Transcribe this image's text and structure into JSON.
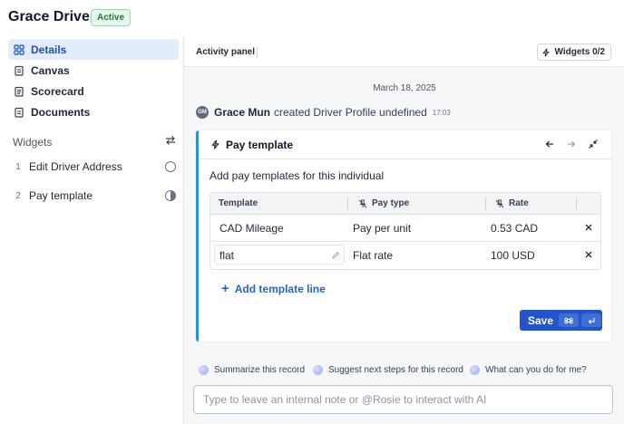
{
  "header": {
    "title": "Grace Driver",
    "status": "Active"
  },
  "sidebar": {
    "nav": [
      {
        "label": "Details",
        "icon": "grid-icon",
        "active": true
      },
      {
        "label": "Canvas",
        "icon": "clipboard-icon",
        "active": false
      },
      {
        "label": "Scorecard",
        "icon": "scorecard-icon",
        "active": false
      },
      {
        "label": "Documents",
        "icon": "document-icon",
        "active": false
      }
    ],
    "widgets_heading": "Widgets",
    "widgets": [
      {
        "num": "1",
        "label": "Edit Driver Address",
        "status": "empty"
      },
      {
        "num": "2",
        "label": "Pay template",
        "status": "in-progress"
      }
    ]
  },
  "main": {
    "tab": "Activity panel",
    "widgets_button": "Widgets 0/2",
    "date": "March 18, 2025",
    "activity": {
      "avatar": "GM",
      "actor": "Grace Mun",
      "action": "created Driver Profile undefined",
      "time": "17:03"
    }
  },
  "pay_template": {
    "title": "Pay template",
    "subtitle": "Add pay templates for this individual",
    "columns": [
      "Template",
      "Pay type",
      "Rate"
    ],
    "rows": [
      {
        "template": "CAD Mileage",
        "pay_type": "Pay per unit",
        "rate": "0.53 CAD"
      },
      {
        "template": "flat",
        "pay_type": "Flat rate",
        "rate": "100 USD"
      }
    ],
    "add_line": "Add template line",
    "save": "Save"
  },
  "suggestions": [
    "Summarize this record",
    "Suggest next steps for this record",
    "What can you do for me?"
  ],
  "note_placeholder": "Type to leave an internal note or @Rosie to interact with AI",
  "colors": {
    "accent": "#2155c9",
    "card_border": "#2f8fd8",
    "active_nav_bg": "#e3ecfb",
    "badge_bg": "#e7f6ec"
  }
}
